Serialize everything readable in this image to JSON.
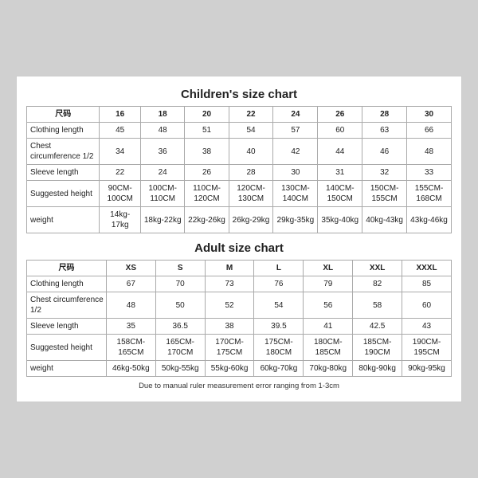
{
  "children_chart": {
    "title": "Children's size chart",
    "columns": [
      "尺码",
      "16",
      "18",
      "20",
      "22",
      "24",
      "26",
      "28",
      "30"
    ],
    "rows": [
      {
        "label": "Clothing length",
        "values": [
          "45",
          "48",
          "51",
          "54",
          "57",
          "60",
          "63",
          "66"
        ]
      },
      {
        "label": "Chest circumference 1/2",
        "values": [
          "34",
          "36",
          "38",
          "40",
          "42",
          "44",
          "46",
          "48"
        ]
      },
      {
        "label": "Sleeve length",
        "values": [
          "22",
          "24",
          "26",
          "28",
          "30",
          "31",
          "32",
          "33"
        ]
      },
      {
        "label": "Suggested height",
        "values": [
          "90CM-100CM",
          "100CM-110CM",
          "110CM-120CM",
          "120CM-130CM",
          "130CM-140CM",
          "140CM-150CM",
          "150CM-155CM",
          "155CM-168CM"
        ]
      },
      {
        "label": "weight",
        "values": [
          "14kg-17kg",
          "18kg-22kg",
          "22kg-26kg",
          "26kg-29kg",
          "29kg-35kg",
          "35kg-40kg",
          "40kg-43kg",
          "43kg-46kg"
        ]
      }
    ]
  },
  "adult_chart": {
    "title": "Adult size chart",
    "columns": [
      "尺码",
      "XS",
      "S",
      "M",
      "L",
      "XL",
      "XXL",
      "XXXL"
    ],
    "rows": [
      {
        "label": "Clothing length",
        "values": [
          "67",
          "70",
          "73",
          "76",
          "79",
          "82",
          "85"
        ]
      },
      {
        "label": "Chest circumference 1/2",
        "values": [
          "48",
          "50",
          "52",
          "54",
          "56",
          "58",
          "60"
        ]
      },
      {
        "label": "Sleeve length",
        "values": [
          "35",
          "36.5",
          "38",
          "39.5",
          "41",
          "42.5",
          "43"
        ]
      },
      {
        "label": "Suggested height",
        "values": [
          "158CM-165CM",
          "165CM-170CM",
          "170CM-175CM",
          "175CM-180CM",
          "180CM-185CM",
          "185CM-190CM",
          "190CM-195CM"
        ]
      },
      {
        "label": "weight",
        "values": [
          "46kg-50kg",
          "50kg-55kg",
          "55kg-60kg",
          "60kg-70kg",
          "70kg-80kg",
          "80kg-90kg",
          "90kg-95kg"
        ]
      }
    ]
  },
  "footer": {
    "note": "Due to manual ruler measurement error ranging from 1-3cm"
  }
}
